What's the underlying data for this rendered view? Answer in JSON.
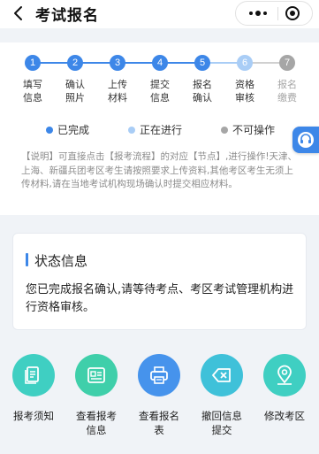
{
  "header": {
    "title": "考试报名",
    "back_icon": "chevron-left-icon"
  },
  "steps": [
    {
      "num": "1",
      "label": "填写\n信息",
      "state": "done"
    },
    {
      "num": "2",
      "label": "确认\n照片",
      "state": "done"
    },
    {
      "num": "3",
      "label": "上传\n材料",
      "state": "done"
    },
    {
      "num": "4",
      "label": "提交\n信息",
      "state": "done"
    },
    {
      "num": "5",
      "label": "报名\n确认",
      "state": "done"
    },
    {
      "num": "6",
      "label": "资格\n审核",
      "state": "progress"
    },
    {
      "num": "7",
      "label": "报名\n缴费",
      "state": "disabled"
    }
  ],
  "legend": {
    "done": "已完成",
    "progress": "正在进行",
    "disabled": "不可操作"
  },
  "colors": {
    "done": "#3d87e8",
    "progress": "#a9cdf6",
    "disabled": "#a6a6a6"
  },
  "note": "【说明】可直接点击【报考流程】的对应【节点】,进行操作!天津、上海、新疆兵团考区考生请按照要求上传资料,其他考区考生无须上传材料,请在当地考试机构现场确认时提交相应材料。",
  "status": {
    "title": "状态信息",
    "text": "您已完成报名确认,请等待考点、考区考试管理机构进行资格审核。"
  },
  "actions": [
    {
      "label": "报考须知",
      "icon": "document-icon",
      "color": "#3fcfc2"
    },
    {
      "label": "查看报考\n信息",
      "icon": "info-card-icon",
      "color": "#3fcfaa"
    },
    {
      "label": "查看报名\n表",
      "icon": "printer-icon",
      "color": "#4693ec"
    },
    {
      "label": "撤回信息\n提交",
      "icon": "backspace-icon",
      "color": "#3fc1d9"
    },
    {
      "label": "修改考区",
      "icon": "location-pin-icon",
      "color": "#3fcfc2"
    }
  ]
}
